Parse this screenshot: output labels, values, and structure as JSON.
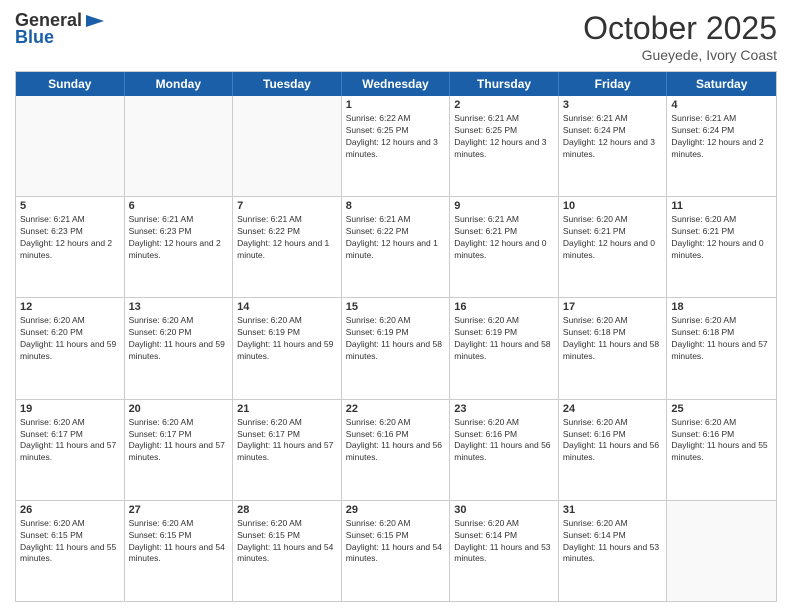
{
  "logo": {
    "line1": "General",
    "line2": "Blue"
  },
  "title": "October 2025",
  "subtitle": "Gueyede, Ivory Coast",
  "header_days": [
    "Sunday",
    "Monday",
    "Tuesday",
    "Wednesday",
    "Thursday",
    "Friday",
    "Saturday"
  ],
  "weeks": [
    [
      {
        "day": "",
        "info": ""
      },
      {
        "day": "",
        "info": ""
      },
      {
        "day": "",
        "info": ""
      },
      {
        "day": "1",
        "info": "Sunrise: 6:22 AM\nSunset: 6:25 PM\nDaylight: 12 hours and 3 minutes."
      },
      {
        "day": "2",
        "info": "Sunrise: 6:21 AM\nSunset: 6:25 PM\nDaylight: 12 hours and 3 minutes."
      },
      {
        "day": "3",
        "info": "Sunrise: 6:21 AM\nSunset: 6:24 PM\nDaylight: 12 hours and 3 minutes."
      },
      {
        "day": "4",
        "info": "Sunrise: 6:21 AM\nSunset: 6:24 PM\nDaylight: 12 hours and 2 minutes."
      }
    ],
    [
      {
        "day": "5",
        "info": "Sunrise: 6:21 AM\nSunset: 6:23 PM\nDaylight: 12 hours and 2 minutes."
      },
      {
        "day": "6",
        "info": "Sunrise: 6:21 AM\nSunset: 6:23 PM\nDaylight: 12 hours and 2 minutes."
      },
      {
        "day": "7",
        "info": "Sunrise: 6:21 AM\nSunset: 6:22 PM\nDaylight: 12 hours and 1 minute."
      },
      {
        "day": "8",
        "info": "Sunrise: 6:21 AM\nSunset: 6:22 PM\nDaylight: 12 hours and 1 minute."
      },
      {
        "day": "9",
        "info": "Sunrise: 6:21 AM\nSunset: 6:21 PM\nDaylight: 12 hours and 0 minutes."
      },
      {
        "day": "10",
        "info": "Sunrise: 6:20 AM\nSunset: 6:21 PM\nDaylight: 12 hours and 0 minutes."
      },
      {
        "day": "11",
        "info": "Sunrise: 6:20 AM\nSunset: 6:21 PM\nDaylight: 12 hours and 0 minutes."
      }
    ],
    [
      {
        "day": "12",
        "info": "Sunrise: 6:20 AM\nSunset: 6:20 PM\nDaylight: 11 hours and 59 minutes."
      },
      {
        "day": "13",
        "info": "Sunrise: 6:20 AM\nSunset: 6:20 PM\nDaylight: 11 hours and 59 minutes."
      },
      {
        "day": "14",
        "info": "Sunrise: 6:20 AM\nSunset: 6:19 PM\nDaylight: 11 hours and 59 minutes."
      },
      {
        "day": "15",
        "info": "Sunrise: 6:20 AM\nSunset: 6:19 PM\nDaylight: 11 hours and 58 minutes."
      },
      {
        "day": "16",
        "info": "Sunrise: 6:20 AM\nSunset: 6:19 PM\nDaylight: 11 hours and 58 minutes."
      },
      {
        "day": "17",
        "info": "Sunrise: 6:20 AM\nSunset: 6:18 PM\nDaylight: 11 hours and 58 minutes."
      },
      {
        "day": "18",
        "info": "Sunrise: 6:20 AM\nSunset: 6:18 PM\nDaylight: 11 hours and 57 minutes."
      }
    ],
    [
      {
        "day": "19",
        "info": "Sunrise: 6:20 AM\nSunset: 6:17 PM\nDaylight: 11 hours and 57 minutes."
      },
      {
        "day": "20",
        "info": "Sunrise: 6:20 AM\nSunset: 6:17 PM\nDaylight: 11 hours and 57 minutes."
      },
      {
        "day": "21",
        "info": "Sunrise: 6:20 AM\nSunset: 6:17 PM\nDaylight: 11 hours and 57 minutes."
      },
      {
        "day": "22",
        "info": "Sunrise: 6:20 AM\nSunset: 6:16 PM\nDaylight: 11 hours and 56 minutes."
      },
      {
        "day": "23",
        "info": "Sunrise: 6:20 AM\nSunset: 6:16 PM\nDaylight: 11 hours and 56 minutes."
      },
      {
        "day": "24",
        "info": "Sunrise: 6:20 AM\nSunset: 6:16 PM\nDaylight: 11 hours and 56 minutes."
      },
      {
        "day": "25",
        "info": "Sunrise: 6:20 AM\nSunset: 6:16 PM\nDaylight: 11 hours and 55 minutes."
      }
    ],
    [
      {
        "day": "26",
        "info": "Sunrise: 6:20 AM\nSunset: 6:15 PM\nDaylight: 11 hours and 55 minutes."
      },
      {
        "day": "27",
        "info": "Sunrise: 6:20 AM\nSunset: 6:15 PM\nDaylight: 11 hours and 54 minutes."
      },
      {
        "day": "28",
        "info": "Sunrise: 6:20 AM\nSunset: 6:15 PM\nDaylight: 11 hours and 54 minutes."
      },
      {
        "day": "29",
        "info": "Sunrise: 6:20 AM\nSunset: 6:15 PM\nDaylight: 11 hours and 54 minutes."
      },
      {
        "day": "30",
        "info": "Sunrise: 6:20 AM\nSunset: 6:14 PM\nDaylight: 11 hours and 53 minutes."
      },
      {
        "day": "31",
        "info": "Sunrise: 6:20 AM\nSunset: 6:14 PM\nDaylight: 11 hours and 53 minutes."
      },
      {
        "day": "",
        "info": ""
      }
    ]
  ]
}
